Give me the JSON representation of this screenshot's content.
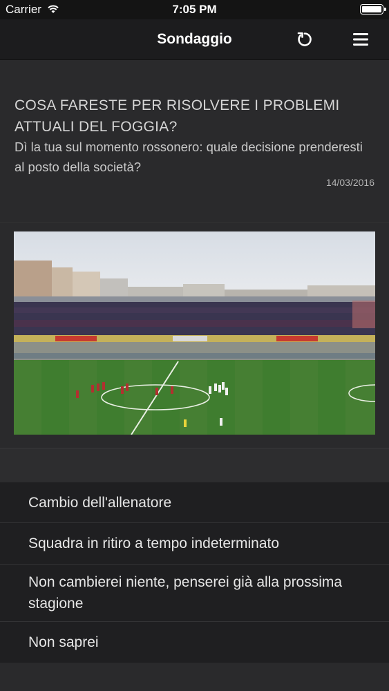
{
  "status_bar": {
    "carrier": "Carrier",
    "time": "7:05 PM"
  },
  "nav": {
    "title": "Sondaggio",
    "refresh_icon": "refresh-icon",
    "menu_icon": "hamburger-menu-icon"
  },
  "poll": {
    "title": "COSA FARESTE PER RISOLVERE I PROBLEMI ATTUALI DEL FOGGIA?",
    "subtitle": "Dì la tua sul momento rossonero: quale decisione prenderesti al posto della società?",
    "date": "14/03/2016",
    "options": [
      {
        "label": "Cambio dell'allenatore"
      },
      {
        "label": "Squadra in ritiro a tempo indeterminato"
      },
      {
        "label": "Non cambierei niente, penserei già alla prossima stagione"
      },
      {
        "label": "Non saprei"
      }
    ]
  }
}
